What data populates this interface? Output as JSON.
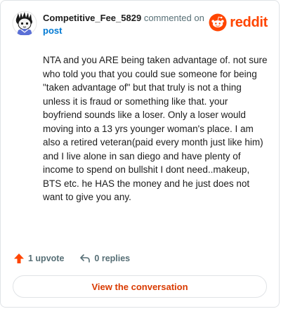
{
  "header": {
    "author": "Competitive_Fee_5829",
    "action_text": "commented on",
    "target_text": "post",
    "logo_text": "reddit"
  },
  "comment": {
    "text": "NTA and you ARE being taken advantage of. not sure who told you that you could sue someone for being \"taken advantage of\" but that truly is not a thing unless it is fraud or something like that. your boyfriend sounds like a loser. Only a loser would moving into a 13 yrs younger woman's place. I am also a retired veteran(paid every month just like him) and I live alone in san diego and have plenty of income to spend on bullshit I dont need..makeup, BTS etc. he HAS the money and he just does not want to give you any."
  },
  "actions": {
    "upvote_icon": "upvote-arrow-icon",
    "upvote_label": "1 upvote",
    "reply_icon": "reply-arrow-icon",
    "replies_label": "0 replies"
  },
  "cta": {
    "view_label": "View the conversation"
  },
  "colors": {
    "brand": "#ff4500",
    "upvote": "#ff4500",
    "link": "#0079d3",
    "cta_text": "#d93a00",
    "text": "#1c1c1c",
    "muted": "#576f76",
    "border": "#e0e3e6"
  }
}
